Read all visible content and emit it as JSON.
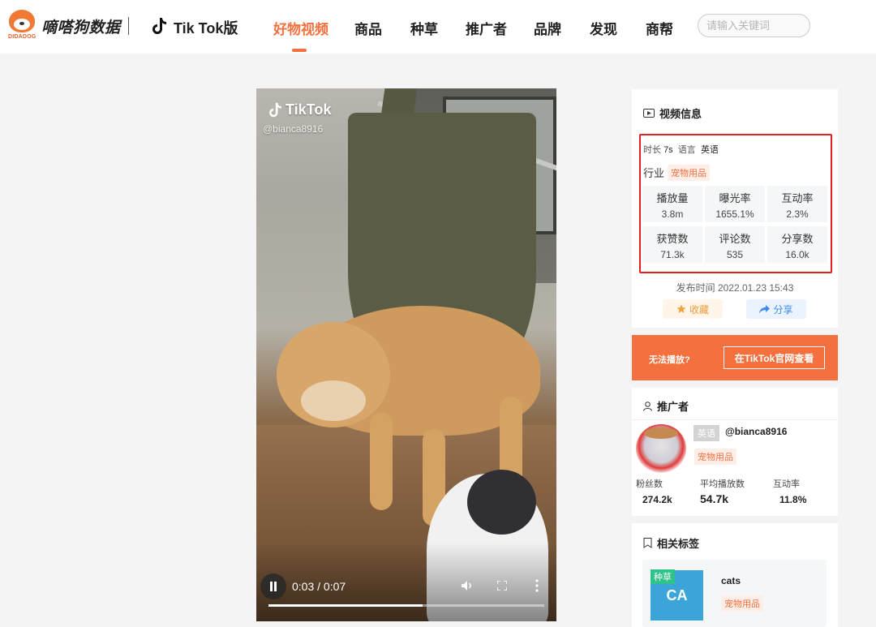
{
  "header": {
    "logo_text": "DIDADOG",
    "brand": "嘀嗒狗数据",
    "platform": "Tik Tok版",
    "nav": [
      "好物视频",
      "商品",
      "种草",
      "推广者",
      "品牌",
      "发现",
      "商帮"
    ],
    "active_nav": "好物视频",
    "search_placeholder": "请输入关键词"
  },
  "video": {
    "watermark": "TikTok",
    "handle": "@bianca8916",
    "current_time": "0:03",
    "separator": "/",
    "duration": "0:07",
    "progress": 0.56
  },
  "video_info": {
    "title": "视频信息",
    "duration_label": "时长",
    "duration_value": "7s",
    "language_label": "语言",
    "language_value": "英语",
    "industry_label": "行业",
    "industry_value": "宠物用品",
    "metrics": [
      {
        "label": "播放量",
        "value": "3.8m"
      },
      {
        "label": "曝光率",
        "value": "1655.1%"
      },
      {
        "label": "互动率",
        "value": "2.3%"
      },
      {
        "label": "获赞数",
        "value": "71.3k"
      },
      {
        "label": "评论数",
        "value": "535"
      },
      {
        "label": "分享数",
        "value": "16.0k"
      }
    ],
    "publish_time": "发布时间 2022.01.23 15:43",
    "favorite_label": "收藏",
    "share_label": "分享"
  },
  "cant_play": {
    "text": "无法播放?",
    "button": "在TikTok官网查看"
  },
  "promoter": {
    "title": "推广者",
    "language": "英语",
    "handle": "@bianca8916",
    "category": "宠物用品",
    "stats": [
      {
        "label": "粉丝数",
        "value": "274.2k"
      },
      {
        "label": "平均播放数",
        "value": "54.7k"
      },
      {
        "label": "互动率",
        "value": "11.8%"
      }
    ]
  },
  "tags": {
    "title": "相关标签",
    "item": {
      "badge": "种草",
      "abbr": "CA",
      "name": "cats",
      "category": "宠物用品"
    }
  },
  "colors": {
    "accent": "#f4703f",
    "highlight_border": "#e62020",
    "share_blue": "#3e8cf2",
    "tag_green": "#2fc28a"
  }
}
